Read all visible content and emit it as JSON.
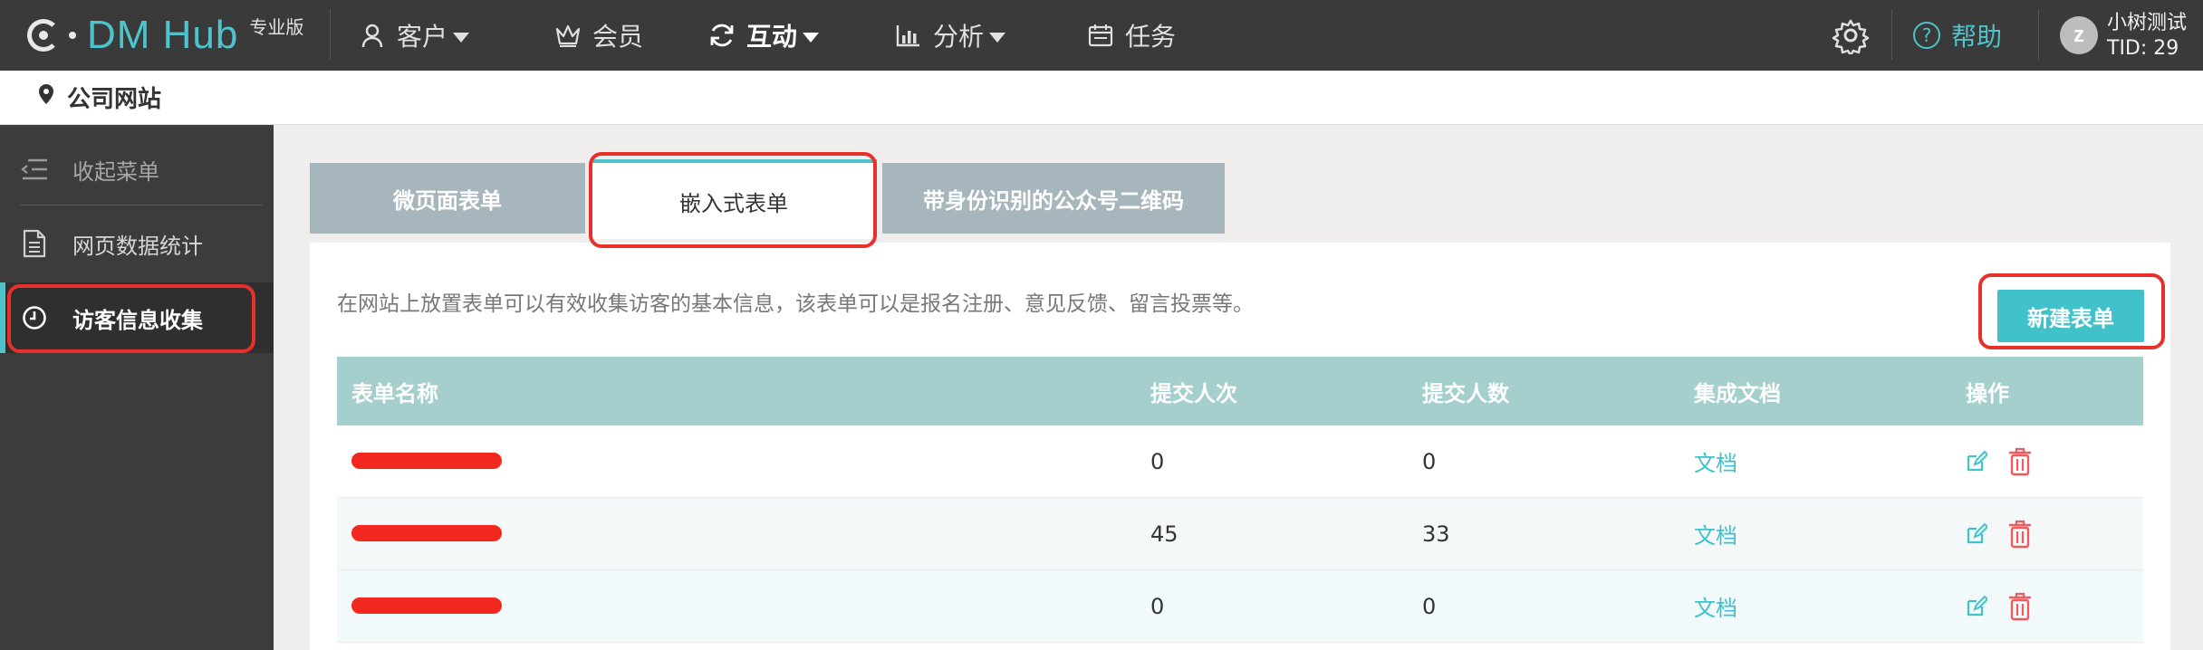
{
  "app": {
    "brand": "DM Hub",
    "edition": "专业版",
    "nav": [
      {
        "label": "客户",
        "icon": "user-icon",
        "has_caret": true,
        "active": false
      },
      {
        "label": "会员",
        "icon": "crown-icon",
        "has_caret": false,
        "active": false
      },
      {
        "label": "互动",
        "icon": "refresh-icon",
        "has_caret": true,
        "active": true
      },
      {
        "label": "分析",
        "icon": "chart-icon",
        "has_caret": true,
        "active": false
      },
      {
        "label": "任务",
        "icon": "calendar-icon",
        "has_caret": false,
        "active": false
      }
    ],
    "help_label": "帮助",
    "user": {
      "avatar_letter": "z",
      "name": "小树测试",
      "tid": "TID: 29"
    }
  },
  "breadcrumb": {
    "label": "公司网站",
    "icon": "location-pin-icon"
  },
  "sidebar": {
    "items": [
      {
        "label": "收起菜单",
        "icon": "collapse-menu-icon"
      },
      {
        "label": "网页数据统计",
        "icon": "document-icon"
      },
      {
        "label": "访客信息收集",
        "icon": "clock-icon"
      }
    ]
  },
  "tabs": [
    {
      "label": "微页面表单",
      "active": false
    },
    {
      "label": "嵌入式表单",
      "active": true
    },
    {
      "label": "带身份识别的公众号二维码",
      "active": false
    }
  ],
  "main": {
    "description": "在网站上放置表单可以有效收集访客的基本信息，该表单可以是报名注册、意见反馈、留言投票等。",
    "new_button": "新建表单",
    "table": {
      "headers": [
        "表单名称",
        "提交人次",
        "提交人数",
        "集成文档",
        "操作"
      ],
      "rows": [
        {
          "name": "",
          "redacted": true,
          "submissions": "0",
          "submitters": "0",
          "doc": "文档"
        },
        {
          "name": "",
          "redacted": true,
          "submissions": "45",
          "submitters": "33",
          "doc": "文档"
        },
        {
          "name": "",
          "redacted": true,
          "submissions": "0",
          "submitters": "0",
          "doc": "文档"
        }
      ]
    }
  },
  "colors": {
    "accent": "#41c1c9",
    "topbar": "#3a3a3a",
    "sidebar": "#3c3c3c",
    "annotation": "#e8302a",
    "redaction": "#f2281e",
    "table_header": "#a4cfcd",
    "tab_inactive": "#a7b6bc"
  }
}
